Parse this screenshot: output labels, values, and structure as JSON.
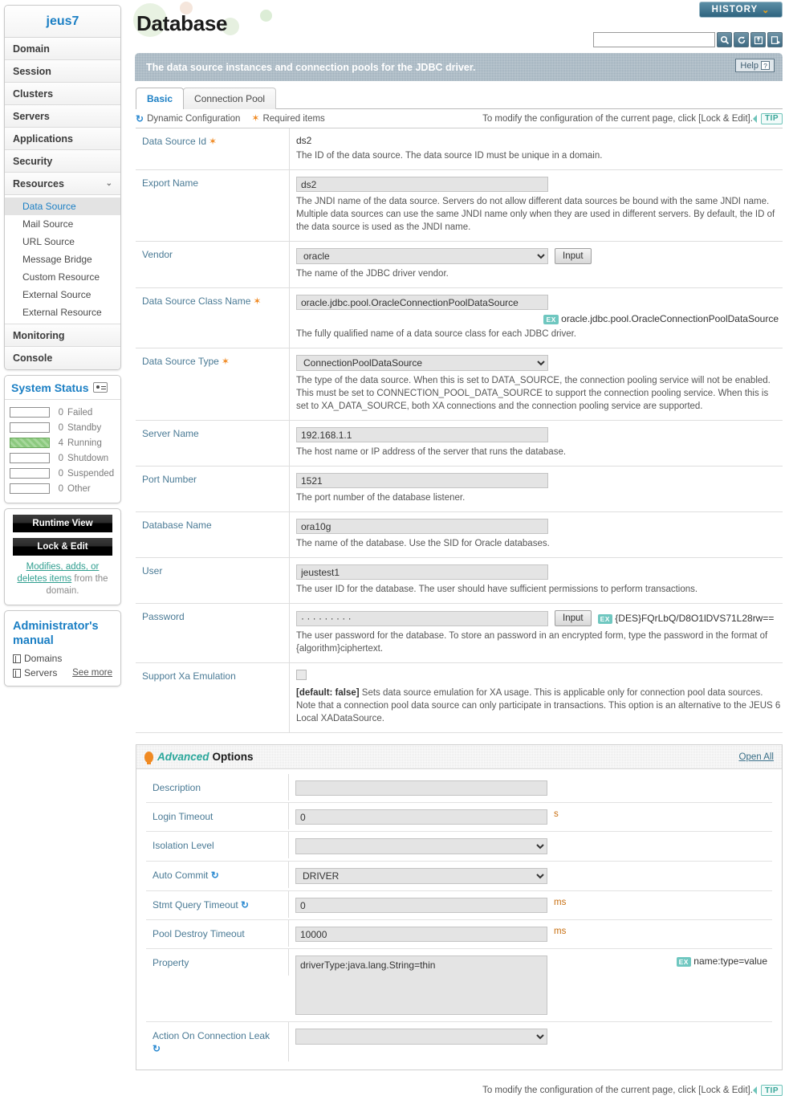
{
  "sidebar": {
    "brand": "jeus7",
    "nav": [
      {
        "label": "Domain",
        "expandable": false
      },
      {
        "label": "Session",
        "expandable": false
      },
      {
        "label": "Clusters",
        "expandable": false
      },
      {
        "label": "Servers",
        "expandable": false
      },
      {
        "label": "Applications",
        "expandable": false
      },
      {
        "label": "Security",
        "expandable": false
      },
      {
        "label": "Resources",
        "expandable": true,
        "chevron": "⌄"
      }
    ],
    "sub_items": [
      {
        "label": "Data Source",
        "active": true
      },
      {
        "label": "Mail Source",
        "active": false
      },
      {
        "label": "URL Source",
        "active": false
      },
      {
        "label": "Message Bridge",
        "active": false
      },
      {
        "label": "Custom Resource",
        "active": false
      },
      {
        "label": "External Source",
        "active": false
      },
      {
        "label": "External Resource",
        "active": false
      }
    ],
    "nav_tail": [
      {
        "label": "Monitoring"
      },
      {
        "label": "Console"
      }
    ],
    "status": {
      "title": "System Status",
      "rows": [
        {
          "count": "0",
          "label": "Failed",
          "filled": false
        },
        {
          "count": "0",
          "label": "Standby",
          "filled": false
        },
        {
          "count": "4",
          "label": "Running",
          "filled": true
        },
        {
          "count": "0",
          "label": "Shutdown",
          "filled": false
        },
        {
          "count": "0",
          "label": "Suspended",
          "filled": false
        },
        {
          "count": "0",
          "label": "Other",
          "filled": false
        }
      ]
    },
    "buttons": {
      "runtime_view": "Runtime View",
      "lock_edit": "Lock & Edit",
      "lock_note_link": "Modifies, adds, or deletes items",
      "lock_note_rest": " from the domain."
    },
    "manual": {
      "title": "Administrator's manual",
      "items": [
        "Domains",
        "Servers"
      ],
      "see_more": "See more"
    }
  },
  "header": {
    "title": "Database",
    "history_label": "HISTORY",
    "history_chevron": "⌄",
    "search_placeholder": "",
    "search_value": "",
    "banner_text": "The data source instances and connection pools for the JDBC driver.",
    "help_label": "Help",
    "help_mark": "?"
  },
  "tabs": [
    {
      "label": "Basic",
      "active": true
    },
    {
      "label": "Connection Pool",
      "active": false
    }
  ],
  "legend": {
    "dynamic": "Dynamic Configuration",
    "required": "Required items",
    "tip_text": "To modify the configuration of the current page, click [Lock & Edit].",
    "tip_badge": "TIP"
  },
  "basic_fields": [
    {
      "name": "Data Source Id",
      "required": true,
      "control": "text-plain",
      "value": "ds2",
      "desc": "The ID of the data source. The data source ID must be unique in a domain."
    },
    {
      "name": "Export Name",
      "required": false,
      "control": "input",
      "value": "ds2",
      "desc": "The JNDI name of the data source. Servers do not allow different data sources be bound with the same JNDI name. Multiple data sources can use the same JNDI name only when they are used in different servers. By default, the ID of the data source is used as the JNDI name."
    },
    {
      "name": "Vendor",
      "required": false,
      "control": "select-button",
      "value": "oracle",
      "button": "Input",
      "desc": "The name of the JDBC driver vendor."
    },
    {
      "name": "Data Source Class Name",
      "required": true,
      "control": "input-example",
      "value": "oracle.jdbc.pool.OracleConnectionPoolDataSource",
      "example_badge": "EX",
      "example": "oracle.jdbc.pool.OracleConnectionPoolDataSource",
      "desc": "The fully qualified name of a data source class for each JDBC driver."
    },
    {
      "name": "Data Source Type",
      "required": true,
      "control": "select",
      "value": "ConnectionPoolDataSource",
      "desc": "The type of the data source. When this is set to DATA_SOURCE, the connection pooling service will not be enabled. This must be set to CONNECTION_POOL_DATA_SOURCE to support the connection pooling service. When this is set to XA_DATA_SOURCE, both XA connections and the connection pooling service are supported."
    },
    {
      "name": "Server Name",
      "required": false,
      "control": "input",
      "value": "192.168.1.1",
      "desc": "The host name or IP address of the server that runs the database."
    },
    {
      "name": "Port Number",
      "required": false,
      "control": "input",
      "value": "1521",
      "desc": "The port number of the database listener."
    },
    {
      "name": "Database Name",
      "required": false,
      "control": "input",
      "value": "ora10g",
      "desc": "The name of the database. Use the SID for Oracle databases."
    },
    {
      "name": "User",
      "required": false,
      "control": "input",
      "value": "jeustest1",
      "desc": "The user ID for the database. The user should have sufficient permissions to perform transactions."
    },
    {
      "name": "Password",
      "required": false,
      "control": "password",
      "value": "· · · · · · · · ·",
      "button": "Input",
      "example_badge": "EX",
      "example": "{DES}FQrLbQ/D8O1lDVS71L28rw==",
      "desc": "The user password for the database. To store an password in an encrypted form, type the password in the format of {algorithm}ciphertext."
    },
    {
      "name": "Support Xa Emulation",
      "required": false,
      "control": "checkbox",
      "checked": false,
      "desc_prefix": "[default: false]",
      "desc": "Sets data source emulation for XA usage. This is applicable only for connection pool data sources. Note that a connection pool data source can only participate in transactions. This option is an alternative to the JEUS 6 Local XADataSource."
    }
  ],
  "advanced": {
    "title_italic": "Advanced",
    "title_bold": "Options",
    "open_all": "Open All",
    "fields": [
      {
        "name": "Description",
        "control": "input",
        "value": "",
        "dynamic": false,
        "unit": ""
      },
      {
        "name": "Login Timeout",
        "control": "input",
        "value": "0",
        "dynamic": false,
        "unit": "s"
      },
      {
        "name": "Isolation Level",
        "control": "select",
        "value": "",
        "dynamic": false,
        "unit": ""
      },
      {
        "name": "Auto Commit",
        "control": "select",
        "value": "DRIVER",
        "dynamic": true,
        "unit": ""
      },
      {
        "name": "Stmt Query Timeout",
        "control": "input",
        "value": "0",
        "dynamic": true,
        "unit": "ms"
      },
      {
        "name": "Pool Destroy Timeout",
        "control": "input",
        "value": "10000",
        "dynamic": false,
        "unit": "ms"
      },
      {
        "name": "Property",
        "control": "textarea",
        "value": "driverType:java.lang.String=thin",
        "dynamic": false,
        "unit": "",
        "example_badge": "EX",
        "example": "name:type=value"
      },
      {
        "name": "Action On Connection Leak",
        "control": "select",
        "value": "",
        "dynamic": true,
        "unit": ""
      }
    ]
  },
  "footer": {
    "tip_text": "To modify the configuration of the current page, click [Lock & Edit].",
    "tip_badge": "TIP"
  }
}
